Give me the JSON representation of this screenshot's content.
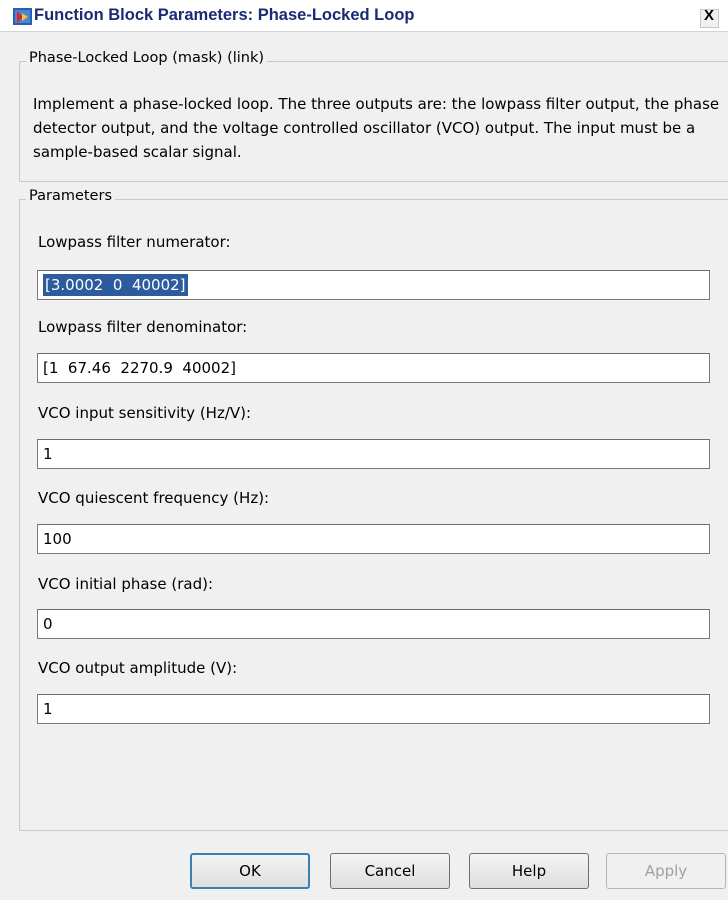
{
  "window": {
    "title": "Function Block Parameters: Phase-Locked Loop",
    "close_glyph": "X"
  },
  "block": {
    "legend": "Phase-Locked Loop (mask) (link)",
    "description": "Implement a phase-locked loop.  The three outputs are:  the lowpass filter output, the phase detector output, and the voltage controlled oscillator (VCO) output.  The input must be a sample-based scalar signal."
  },
  "parameters": {
    "legend": "Parameters",
    "fields": [
      {
        "label": "Lowpass filter numerator:",
        "value": "[3.0002  0  40002]"
      },
      {
        "label": "Lowpass filter denominator:",
        "value": "[1  67.46  2270.9  40002]"
      },
      {
        "label": "VCO input sensitivity (Hz/V):",
        "value": "1"
      },
      {
        "label": "VCO quiescent frequency (Hz):",
        "value": "100"
      },
      {
        "label": "VCO initial phase (rad):",
        "value": "0"
      },
      {
        "label": "VCO output amplitude (V):",
        "value": "1"
      }
    ]
  },
  "buttons": {
    "ok": "OK",
    "cancel": "Cancel",
    "help": "Help",
    "apply": "Apply"
  }
}
